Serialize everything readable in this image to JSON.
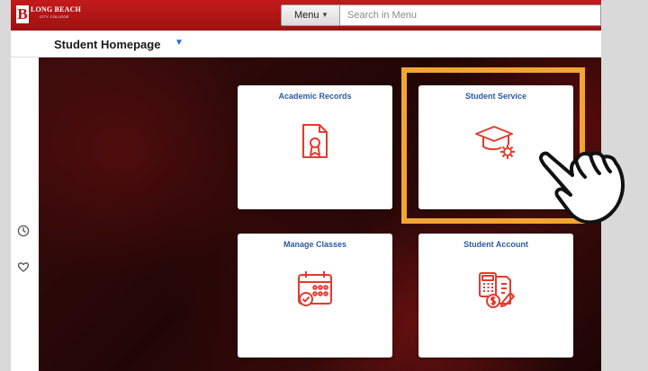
{
  "header": {
    "logo_letter": "B",
    "logo_name": "LONG BEACH",
    "logo_sub": "CITY COLLEGE",
    "menu_label": "Menu",
    "search_placeholder": "Search in Menu"
  },
  "page": {
    "title": "Student Homepage"
  },
  "tiles": [
    {
      "label": "Academic Records",
      "icon": "certificate-document-icon"
    },
    {
      "label": "Student Service",
      "icon": "graduation-cap-gear-icon"
    },
    {
      "label": "Manage Classes",
      "icon": "calendar-check-icon"
    },
    {
      "label": "Student Account",
      "icon": "calculator-invoice-icon"
    }
  ],
  "rail": {
    "icons": [
      "clock-icon",
      "heart-icon"
    ]
  },
  "colors": {
    "brand_red": "#b31212",
    "tile_title_blue": "#2a5aa8",
    "icon_red": "#e23b2e",
    "highlight_orange": "#f2a532"
  }
}
